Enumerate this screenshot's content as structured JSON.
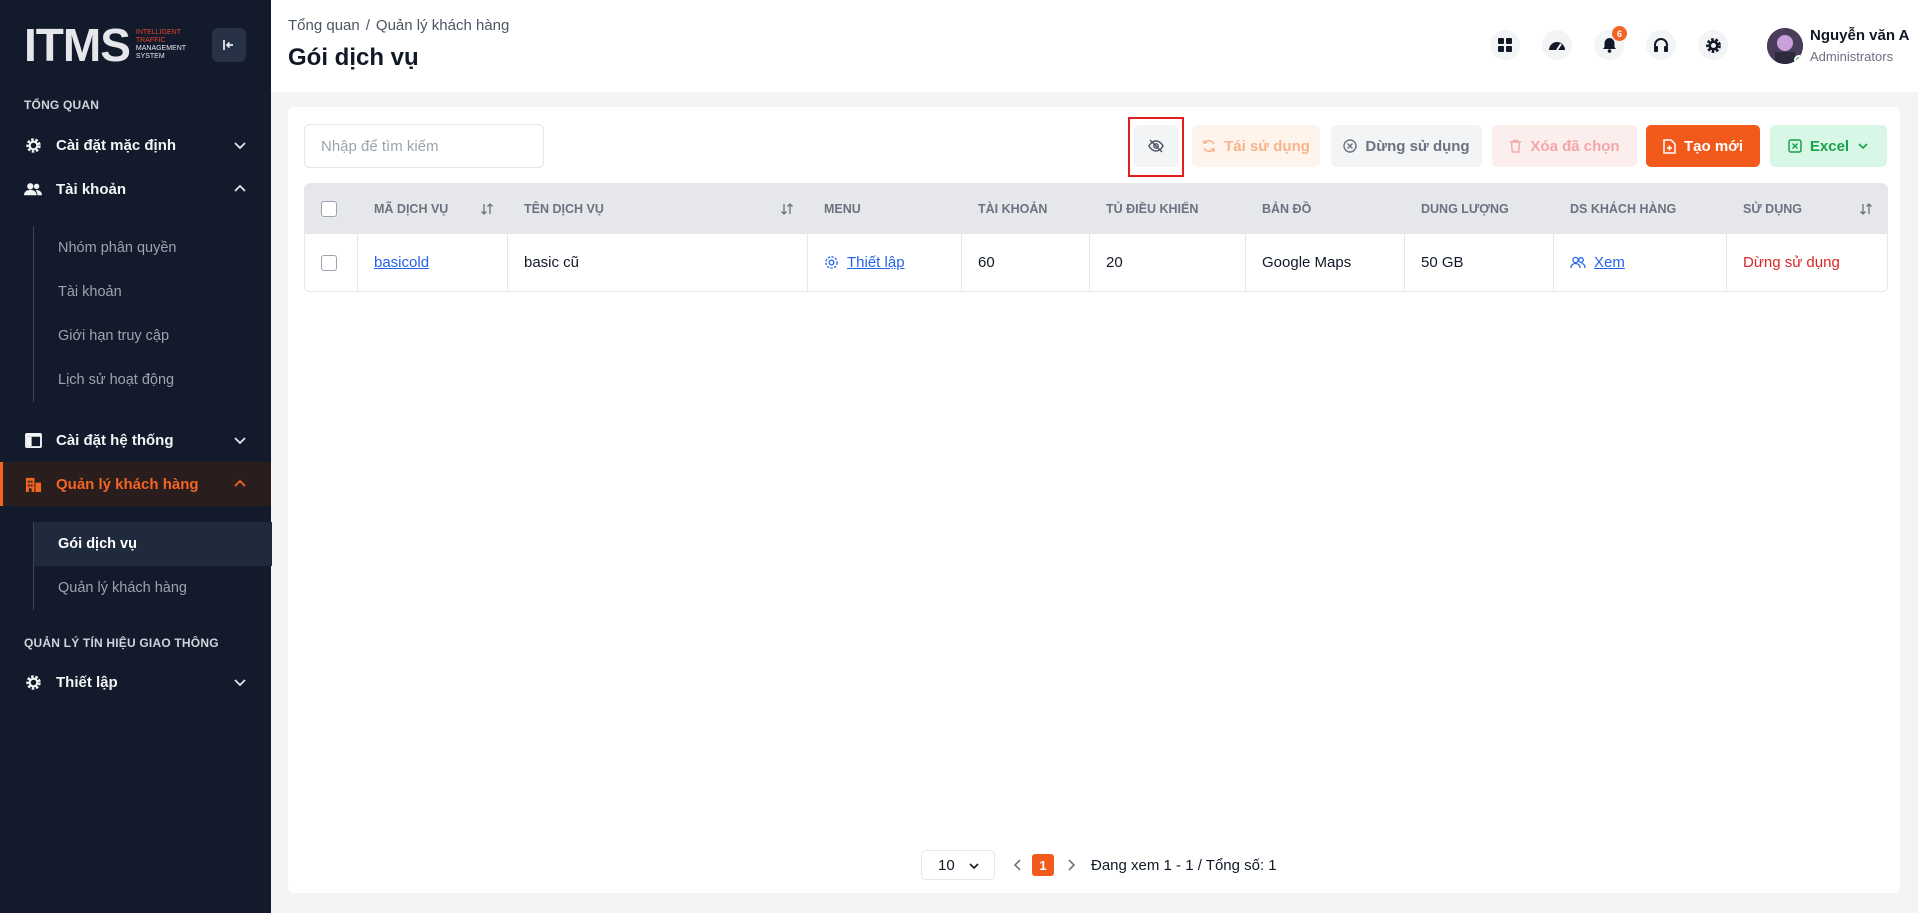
{
  "brand": {
    "logo_text": "ITMS",
    "logo_sub_line1": "INTELLIGENT",
    "logo_sub_line2": "TRAFFIC",
    "logo_sub_line3": "MANAGEMENT",
    "logo_sub_line4": "SYSTEM"
  },
  "sidebar": {
    "section_overview": "TỔNG QUAN",
    "section_traffic": "QUẢN LÝ TÍN HIỆU GIAO THÔNG",
    "items": [
      {
        "label": "Cài đặt mặc định",
        "icon": "gear-icon"
      },
      {
        "label": "Tài khoản",
        "icon": "users-icon"
      },
      {
        "label": "Cài đặt hệ thống",
        "icon": "window-icon"
      },
      {
        "label": "Quản lý khách hàng",
        "icon": "building-icon"
      },
      {
        "label": "Thiết lập",
        "icon": "gear-icon"
      }
    ],
    "account_sub": [
      "Nhóm phân quyền",
      "Tài khoản",
      "Giới hạn truy cập",
      "Lịch sử hoạt động"
    ],
    "customer_sub": [
      "Gói dịch vụ",
      "Quản lý khách hàng"
    ]
  },
  "header": {
    "breadcrumb": [
      "Tổng quan",
      "Quản lý khách hàng"
    ],
    "breadcrumb_sep": "/",
    "title": "Gói dịch vụ",
    "notification_count": "6",
    "user_name": "Nguyễn văn A",
    "user_role": "Administrators"
  },
  "toolbar": {
    "search_placeholder": "Nhập để tìm kiếm",
    "reuse_label": "Tái sử dụng",
    "stop_label": "Dừng sử dụng",
    "delete_label": "Xóa đã chọn",
    "new_label": "Tạo mới",
    "excel_label": "Excel"
  },
  "table": {
    "columns": [
      "MÃ DỊCH VỤ",
      "TÊN DỊCH VỤ",
      "MENU",
      "TÀI KHOẢN",
      "TỦ ĐIỀU KHIỂN",
      "BẢN ĐỒ",
      "DUNG LƯỢNG",
      "DS KHÁCH HÀNG",
      "SỬ DỤNG"
    ],
    "rows": [
      {
        "code": "basicold",
        "name": "basic cũ",
        "menu": "Thiết lập",
        "accounts": "60",
        "controllers": "20",
        "map": "Google Maps",
        "storage": "50 GB",
        "customers": "Xem",
        "status": "Dừng sử dụng"
      }
    ]
  },
  "pagination": {
    "page_size": "10",
    "current_page": "1",
    "info": "Đang xem 1 - 1 / Tổng số: 1"
  },
  "colors": {
    "accent": "#f15a1b",
    "sidebar_bg": "#121a2b",
    "danger": "#dc2626",
    "link": "#2563eb",
    "success": "#16a34a"
  }
}
